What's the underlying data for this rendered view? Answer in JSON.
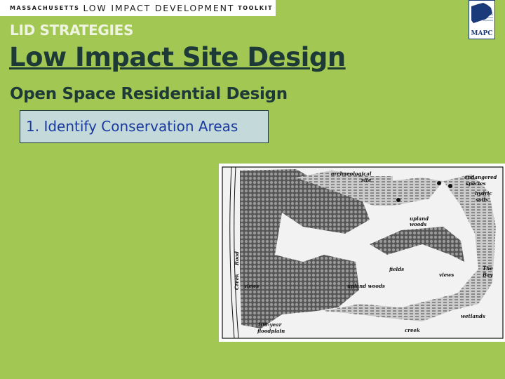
{
  "banner": {
    "prefix": "MASSACHUSETTS",
    "main": "LOW IMPACT DEVELOPMENT",
    "suffix": "TOOLKIT"
  },
  "logo": {
    "text": "MAPC"
  },
  "kicker": "LID STRATEGIES",
  "title": "Low Impact Site Design",
  "subtitle": "Open Space Residential Design",
  "step": "1. Identify Conservation Areas",
  "map": {
    "labels": {
      "archaeological": "archaeological",
      "site": "site",
      "endangered": "endangered",
      "species": "species",
      "hydric": "hydric",
      "soils": "soils",
      "upland1": "upland",
      "woods1": "woods",
      "fields": "fields",
      "views1": "views",
      "views2": "views",
      "the": "The",
      "bay": "Bay",
      "upland_woods": "upland woods",
      "road": "Road",
      "creek_road": "Creek",
      "floodplain1": "100-year",
      "floodplain2": "floodplain",
      "creek": "creek",
      "wetlands": "wetlands"
    }
  },
  "colors": {
    "background": "#a2c853",
    "heading": "#1e3a38",
    "step_text": "#1a3aa0",
    "step_box": "#c4d9d9"
  }
}
